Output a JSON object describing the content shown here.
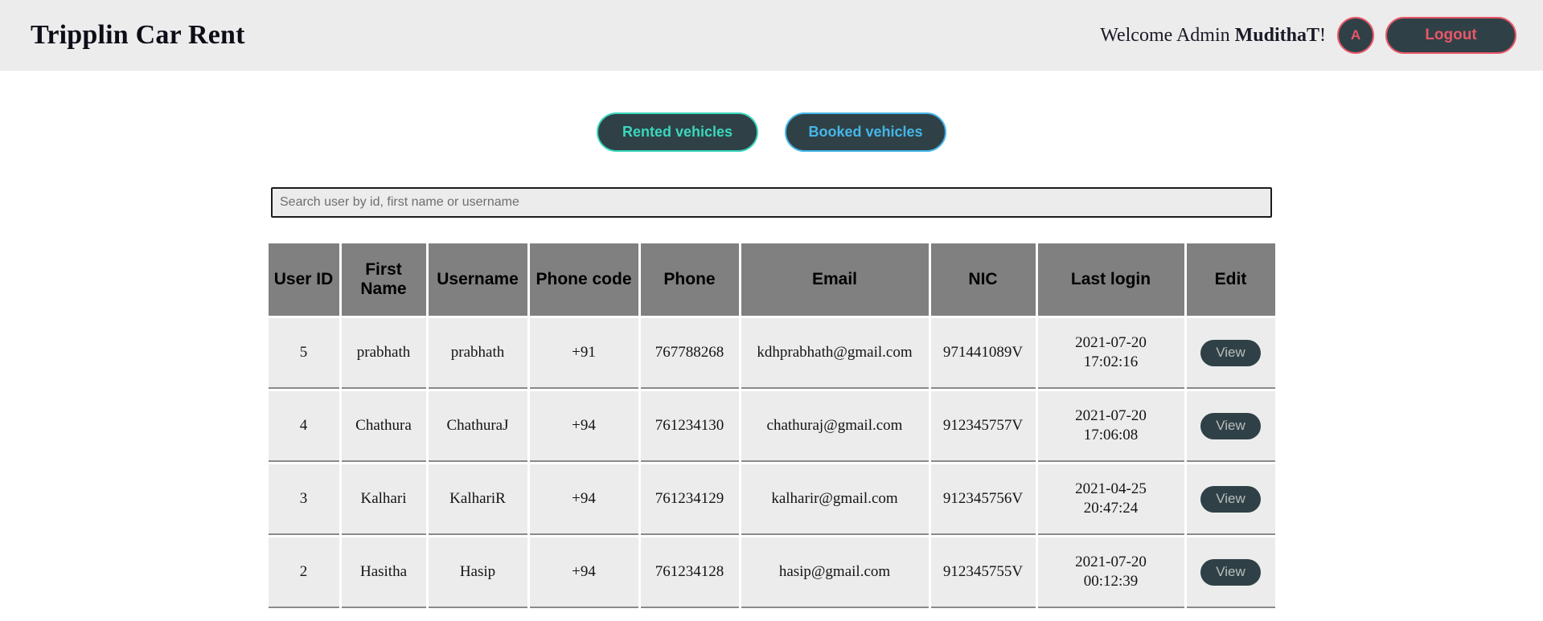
{
  "header": {
    "brand": "Tripplin Car Rent",
    "welcome_prefix": "Welcome Admin ",
    "welcome_name": "MudithaT",
    "welcome_suffix": "!",
    "avatar_initial": "A",
    "logout_label": "Logout",
    "accent_red": "#e9566a",
    "dark_slate": "#2f4146",
    "bar_background": "#ececec"
  },
  "nav": {
    "rented_label": "Rented vehicles",
    "rented_color": "#3ad7bd",
    "booked_label": "Booked vehicles",
    "booked_color": "#46b6e8"
  },
  "search": {
    "placeholder": "Search user by id, first name or username",
    "value": ""
  },
  "table": {
    "headers": {
      "user_id": "User ID",
      "first_name": "First Name",
      "username": "Username",
      "phone_code": "Phone code",
      "phone": "Phone",
      "email": "Email",
      "nic": "NIC",
      "last_login": "Last login",
      "edit": "Edit"
    },
    "header_background": "#808080",
    "row_background": "#ececec",
    "view_label": "View",
    "rows": [
      {
        "user_id": "5",
        "first_name": "prabhath",
        "username": "prabhath",
        "phone_code": "+91",
        "phone": "767788268",
        "email": "kdhprabhath@gmail.com",
        "nic": "971441089V",
        "last_login": "2021-07-20 17:02:16",
        "action": "View"
      },
      {
        "user_id": "4",
        "first_name": "Chathura",
        "username": "ChathuraJ",
        "phone_code": "+94",
        "phone": "761234130",
        "email": "chathuraj@gmail.com",
        "nic": "912345757V",
        "last_login": "2021-07-20 17:06:08",
        "action": "View"
      },
      {
        "user_id": "3",
        "first_name": "Kalhari",
        "username": "KalhariR",
        "phone_code": "+94",
        "phone": "761234129",
        "email": "kalharir@gmail.com",
        "nic": "912345756V",
        "last_login": "2021-04-25 20:47:24",
        "action": "View"
      },
      {
        "user_id": "2",
        "first_name": "Hasitha",
        "username": "Hasip",
        "phone_code": "+94",
        "phone": "761234128",
        "email": "hasip@gmail.com",
        "nic": "912345755V",
        "last_login": "2021-07-20 00:12:39",
        "action": "View"
      }
    ]
  }
}
